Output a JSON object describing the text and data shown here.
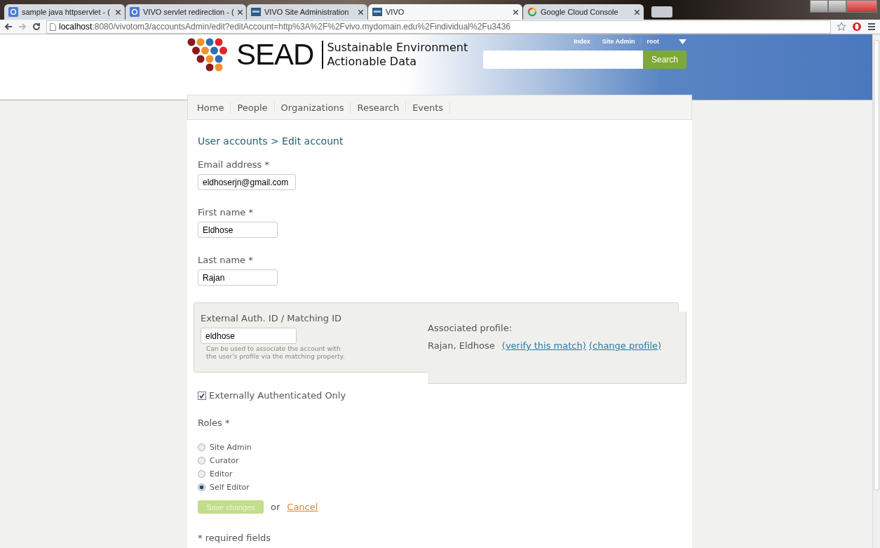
{
  "browser": {
    "tabs": [
      {
        "title": "sample java httpservlet - (",
        "selected": false
      },
      {
        "title": "VIVO servlet redirection - (",
        "selected": false
      },
      {
        "title": "VIVO Site Administration",
        "selected": false
      },
      {
        "title": "VIVO",
        "selected": true
      },
      {
        "title": "Google Cloud Console",
        "selected": false
      }
    ],
    "address_host": "localhost",
    "address_rest": ":8080/vivotom3/accountsAdmin/edit?editAccount=http%3A%2F%2Fvivo.mydomain.edu%2Findividual%2Fu3436"
  },
  "header": {
    "logo_text": "SEAD",
    "tagline": [
      "Sustainable Environment",
      "Actionable Data"
    ],
    "top_links": [
      "Index",
      "Site Admin",
      "root"
    ],
    "search_button": "Search"
  },
  "nav": [
    "Home",
    "People",
    "Organizations",
    "Research",
    "Events"
  ],
  "breadcrumb": "User accounts > Edit account",
  "fields": [
    {
      "label": "Email address *",
      "value": "eldhoserjn@gmail.com"
    },
    {
      "label": "First name *",
      "value": "Eldhose"
    },
    {
      "label": "Last name *",
      "value": "Rajan"
    }
  ],
  "external": {
    "label": "External Auth. ID / Matching ID",
    "value": "eldhose",
    "help": "Can be used to associate the account with the user's profile via the matching property.",
    "associated_label": "Associated profile:",
    "profile_name": "Rajan, Eldhose",
    "links": [
      "(verify this match)",
      "(change profile)"
    ]
  },
  "external_only": {
    "label": "Externally Authenticated Only",
    "checked": true
  },
  "roles": {
    "title": "Roles *",
    "options": [
      {
        "label": "Site Admin",
        "selected": false
      },
      {
        "label": "Curator",
        "selected": false
      },
      {
        "label": "Editor",
        "selected": false
      },
      {
        "label": "Self Editor",
        "selected": true
      }
    ]
  },
  "save_button": {
    "label": "Save changes",
    "disabled": true
  },
  "or_text": "or",
  "cancel_link": "Cancel",
  "footnote": "* required fields"
}
